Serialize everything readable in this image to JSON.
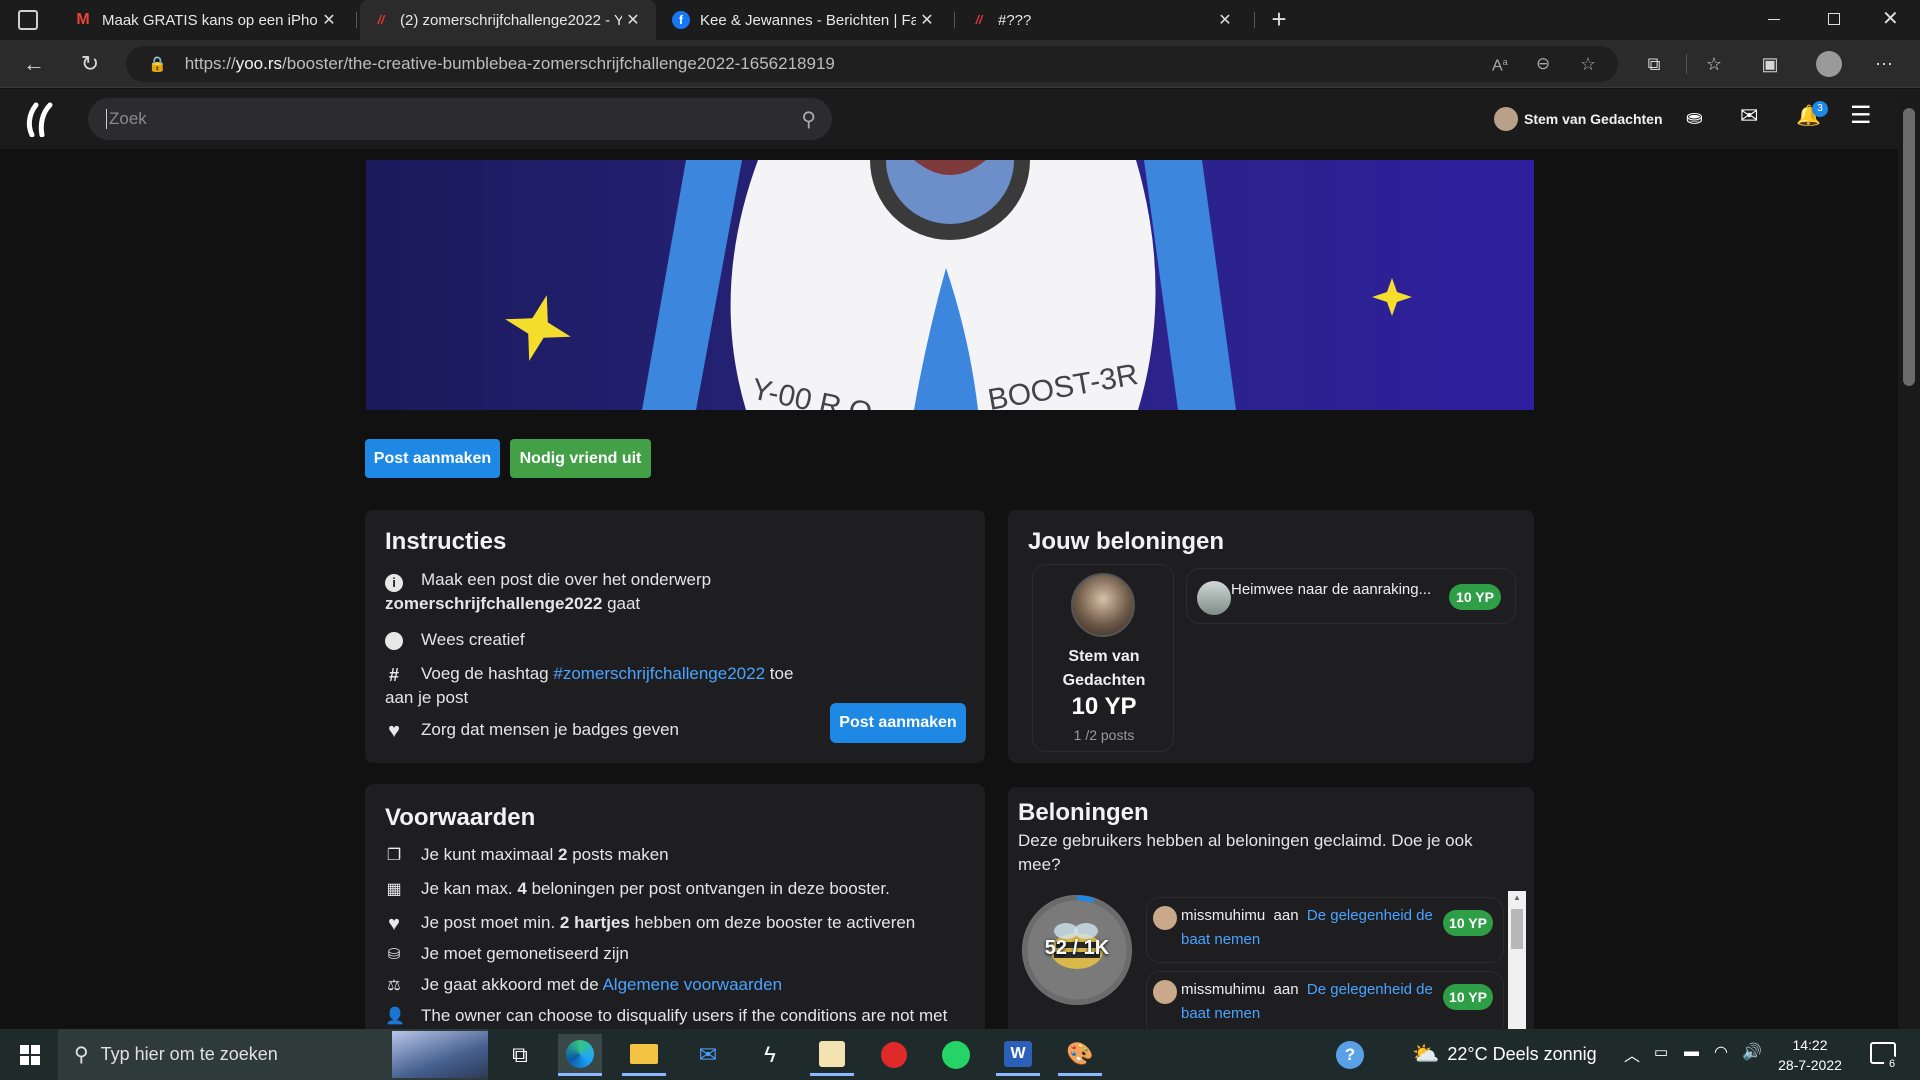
{
  "browser": {
    "tabs": [
      {
        "title": "Maak GRATIS kans op een iPhone",
        "icon": "gmail-icon",
        "active": false
      },
      {
        "title": "(2) zomerschrijfchallenge2022 - Y",
        "icon": "yoors-icon",
        "active": true
      },
      {
        "title": "Kee & Jewannes - Berichten | Face",
        "icon": "facebook-icon",
        "active": false
      },
      {
        "title": "#???",
        "icon": "yoors-icon",
        "active": false
      }
    ],
    "url_prefix": "https://",
    "url_host": "yoo.rs",
    "url_path": "/booster/the-creative-bumblebea-zomerschrijfchallenge2022-1656218919"
  },
  "site": {
    "search_placeholder": "Zoek",
    "user_name": "Stem van Gedachten",
    "notification_count": "3"
  },
  "banner": {
    "rocket_text_left": "Y-00 R.O",
    "rocket_text_right": "BOOST-3R"
  },
  "actions": {
    "post_button": "Post aanmaken",
    "invite_button": "Nodig vriend uit"
  },
  "instructions": {
    "title": "Instructies",
    "line1_a": "Maak een post die over het onderwerp",
    "line1_topic": "zomerschrijfchallenge2022",
    "line1_b": "gaat",
    "line2": "Wees creatief",
    "line3_a": "Voeg de hashtag",
    "line3_tag": "#zomerschrijfchallenge2022",
    "line3_b": "toe",
    "line3_c": "aan je post",
    "line4": "Zorg dat mensen je badges geven",
    "post_button": "Post aanmaken"
  },
  "rewards_mine": {
    "title": "Jouw beloningen",
    "user_name_1": "Stem van",
    "user_name_2": "Gedachten",
    "points": "10 YP",
    "posts": "1 /2 posts",
    "item_title": "Heimwee naar de aanraking...",
    "item_badge": "10 YP"
  },
  "conditions": {
    "title": "Voorwaarden",
    "c1_a": "Je kunt maximaal",
    "c1_b": "2",
    "c1_c": "posts maken",
    "c2_a": "Je kan max.",
    "c2_b": "4",
    "c2_c": "beloningen per post ontvangen in deze booster.",
    "c3_a": "Je post moet min.",
    "c3_b": "2 hartjes",
    "c3_c": "hebben om deze booster te activeren",
    "c4": "Je moet gemonetiseerd zijn",
    "c5_a": "Je gaat akkoord met de",
    "c5_link": "Algemene voorwaarden",
    "c6": "The owner can choose to disqualify users if the conditions are not met"
  },
  "rewards_all": {
    "title": "Beloningen",
    "subtitle_1": "Deze gebruikers hebben al beloningen geclaimd. Doe je ook",
    "subtitle_2": "mee?",
    "badge_count": "52 / 1K",
    "badge_progress": 0.052,
    "claims": [
      {
        "user": "missmuhimu",
        "to": "aan",
        "post_1": "De gelegenheid de",
        "post_2": "baat nemen",
        "badge": "10 YP"
      },
      {
        "user": "missmuhimu",
        "to": "aan",
        "post_1": "De gelegenheid de",
        "post_2": "baat nemen",
        "badge": "10 YP"
      }
    ]
  },
  "taskbar": {
    "search_placeholder": "Typ hier om te zoeken",
    "weather": "22°C  Deels zonnig",
    "time": "14:22",
    "date": "28-7-2022",
    "notifications": "6"
  },
  "colors": {
    "blue": "#1e88e5",
    "green": "#43a047",
    "badge_green": "#2e9e47",
    "link": "#4aa3ff"
  }
}
